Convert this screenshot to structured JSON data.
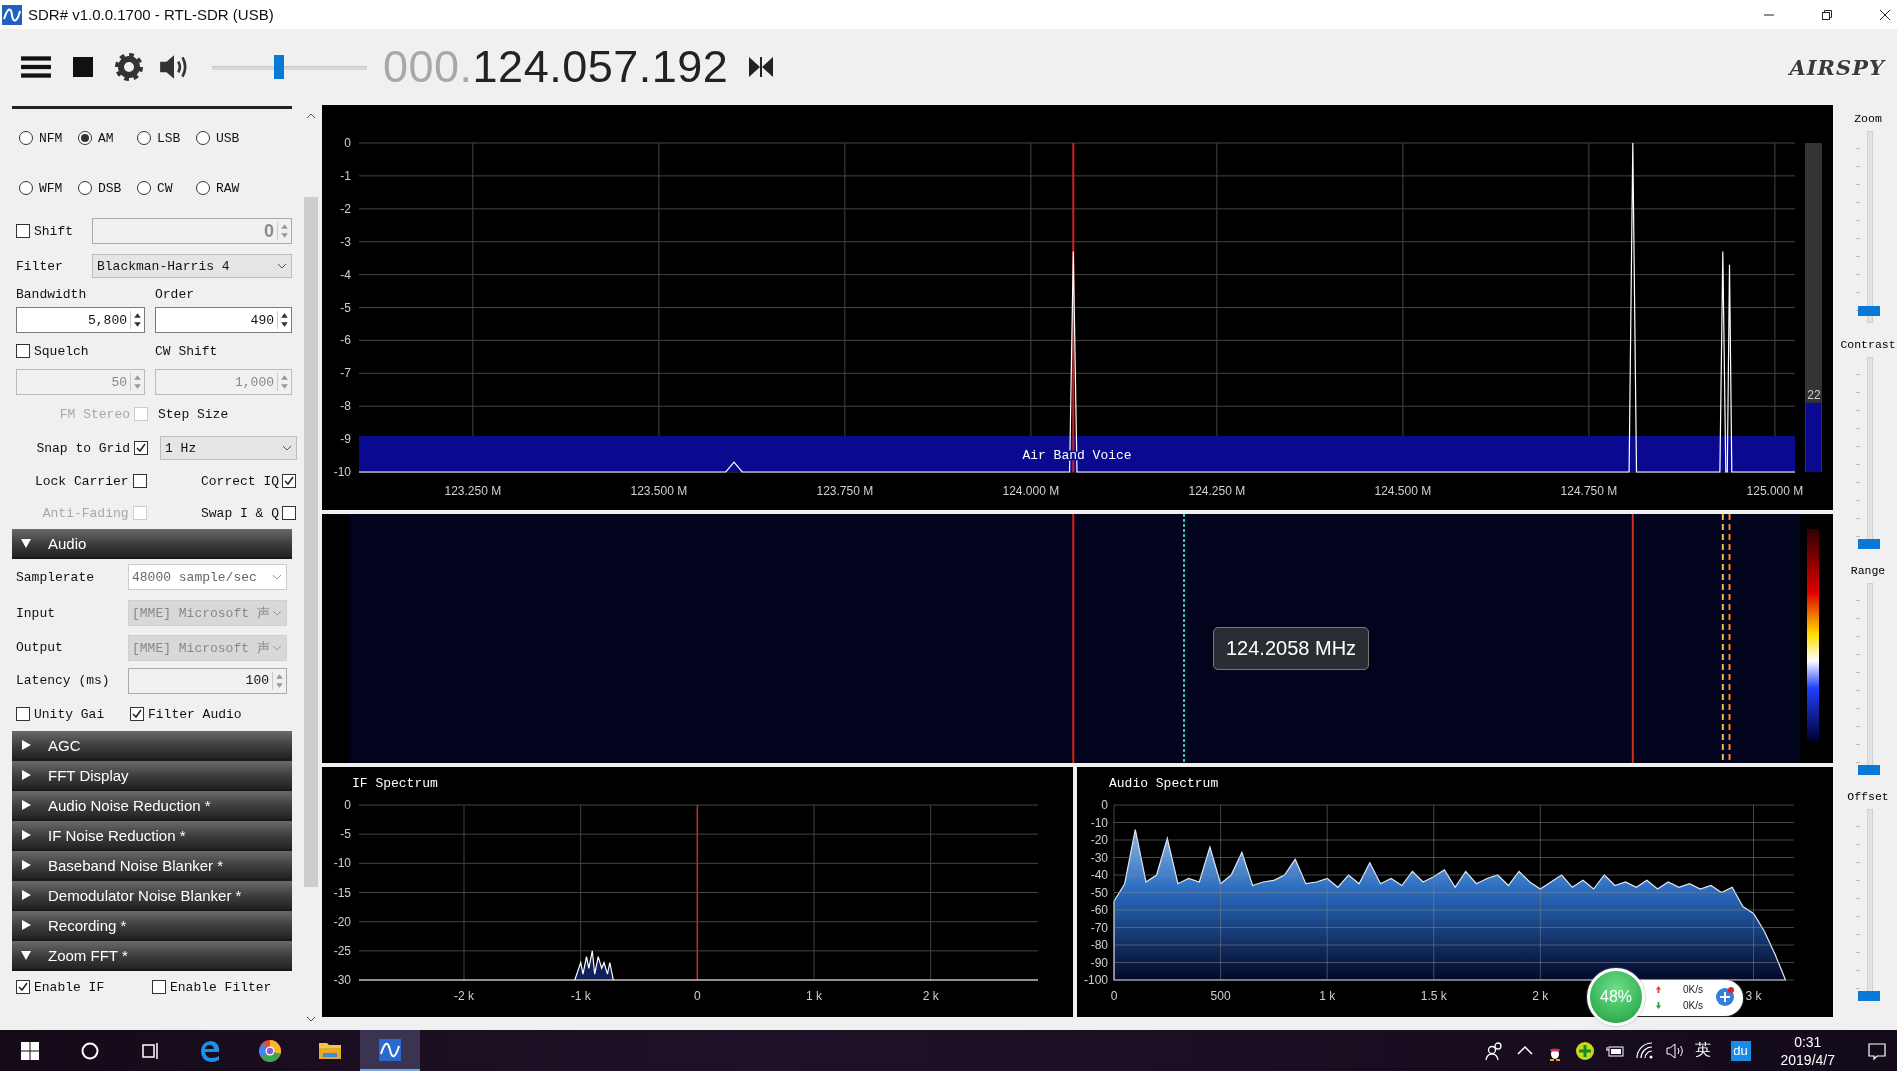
{
  "window": {
    "title": "SDR# v1.0.0.1700 - RTL-SDR (USB)"
  },
  "toolbar": {
    "volume": {
      "level": 0.43
    },
    "frequency": {
      "leading": "000.",
      "digits": "124.057.192"
    },
    "logo": "AIRSPY"
  },
  "modes": [
    {
      "label": "NFM",
      "selected": false
    },
    {
      "label": "AM",
      "selected": true
    },
    {
      "label": "LSB",
      "selected": false
    },
    {
      "label": "USB",
      "selected": false
    },
    {
      "label": "WFM",
      "selected": false
    },
    {
      "label": "DSB",
      "selected": false
    },
    {
      "label": "CW",
      "selected": false
    },
    {
      "label": "RAW",
      "selected": false
    }
  ],
  "shift": {
    "label": "Shift",
    "checked": false,
    "value": "0"
  },
  "filter": {
    "label": "Filter",
    "value": "Blackman-Harris 4"
  },
  "bandwidth": {
    "label": "Bandwidth",
    "value": "5,800"
  },
  "order": {
    "label": "Order",
    "value": "490"
  },
  "squelch": {
    "label": "Squelch",
    "checked": false,
    "value": "50",
    "disabled": true
  },
  "cw_shift": {
    "label": "CW Shift",
    "value": "1,000",
    "disabled": true
  },
  "left_options": [
    {
      "label": "FM Stereo",
      "checked": false,
      "disabled": true
    },
    {
      "label": "Snap to Grid",
      "checked": true,
      "disabled": false
    },
    {
      "label": "Lock Carrier",
      "checked": false,
      "disabled": false
    },
    {
      "label": "Anti-Fading",
      "checked": false,
      "disabled": true
    }
  ],
  "step_size": {
    "label": "Step Size",
    "value": "1 Hz"
  },
  "right_options": [
    {
      "label": "Correct IQ",
      "checked": true
    },
    {
      "label": "Swap I & Q",
      "checked": false
    }
  ],
  "audio": {
    "title": "Audio",
    "expanded": true,
    "fields": [
      {
        "kind": "dropdown",
        "label": "Samplerate",
        "value": "48000 sample/sec",
        "disabled": false
      },
      {
        "kind": "dropdown",
        "label": "Input",
        "value": "[MME] Microsoft 声",
        "disabled": true
      },
      {
        "kind": "dropdown",
        "label": "Output",
        "value": "[MME] Microsoft 声",
        "disabled": true
      },
      {
        "kind": "spinner",
        "label": "Latency (ms)",
        "value": "100",
        "disabled": false
      }
    ],
    "checks": [
      {
        "label": "Unity Gai",
        "checked": false
      },
      {
        "label": "Filter Audio",
        "checked": true
      }
    ]
  },
  "sections": [
    {
      "title": "AGC",
      "expanded": false
    },
    {
      "title": "FFT Display",
      "expanded": false
    },
    {
      "title": "Audio Noise Reduction *",
      "expanded": false
    },
    {
      "title": "IF Noise Reduction *",
      "expanded": false
    },
    {
      "title": "Baseband Noise Blanker *",
      "expanded": false
    },
    {
      "title": "Demodulator Noise Blanker *",
      "expanded": false
    },
    {
      "title": "Recording *",
      "expanded": false
    },
    {
      "title": "Zoom FFT *",
      "expanded": true
    }
  ],
  "zoom_fft": {
    "checks": [
      {
        "label": "Enable IF",
        "checked": true
      },
      {
        "label": "Enable Filter",
        "checked": false
      }
    ]
  },
  "spectrum": {
    "meter": {
      "label": "22",
      "level": 0.21
    },
    "chart_data": {
      "type": "line",
      "x": [
        123.097,
        123.59,
        123.601,
        123.612,
        124.052,
        124.057,
        124.062,
        124.804,
        124.809,
        124.814,
        124.926,
        124.93,
        124.934,
        124.936,
        124.939,
        124.942,
        125.027
      ],
      "series": [
        {
          "color": "#ffffff",
          "values": [
            -10,
            -10,
            -9.7,
            -10,
            -10,
            -3.3,
            -10,
            -10,
            0,
            -10,
            -10,
            -3.3,
            -10,
            -10,
            -3.7,
            -10,
            -10
          ]
        }
      ],
      "xlim": [
        123.097,
        125.027
      ],
      "ylim": [
        -10,
        0
      ],
      "grid": true,
      "bands": [
        {
          "axis": "y",
          "from": -10,
          "to": -8.9,
          "color": "#0a0a90",
          "label": "Air Band Voice"
        }
      ],
      "ref_lines": [
        {
          "axis": "x",
          "value": 124.057,
          "color": "#d02020"
        }
      ],
      "xticks": [
        {
          "value": 123.25,
          "label": "123.250 M"
        },
        {
          "value": 123.5,
          "label": "123.500 M"
        },
        {
          "value": 123.75,
          "label": "123.750 M"
        },
        {
          "value": 124,
          "label": "124.000 M"
        },
        {
          "value": 124.25,
          "label": "124.250 M"
        },
        {
          "value": 124.5,
          "label": "124.500 M"
        },
        {
          "value": 124.75,
          "label": "124.750 M"
        },
        {
          "value": 125,
          "label": "125.000 M"
        }
      ],
      "yticks": [
        0,
        -1,
        -2,
        -3,
        -4,
        -5,
        -6,
        -7,
        -8,
        -9,
        -10
      ]
    }
  },
  "waterfall": {
    "tooltip": "124.2058 MHz"
  },
  "if_spectrum": {
    "title": "IF Spectrum",
    "chart_data": {
      "type": "area",
      "x": [
        -2.9,
        -1.05,
        -1.0,
        -0.98,
        -0.95,
        -0.93,
        -0.9,
        -0.88,
        -0.85,
        -0.82,
        -0.8,
        -0.77,
        -0.75,
        -0.72,
        2.92
      ],
      "series": [
        {
          "color": "#ffffff",
          "values": [
            -30,
            -30,
            -27,
            -29,
            -26,
            -28,
            -25,
            -29,
            -26,
            -28,
            -27,
            -29,
            -27,
            -30,
            -30
          ]
        }
      ],
      "xlim": [
        -2.9,
        2.92
      ],
      "ylim": [
        -30,
        0
      ],
      "grid": true,
      "ref_lines": [
        {
          "axis": "x",
          "value": 0,
          "color": "#d02020"
        }
      ],
      "xticks": [
        {
          "value": -2,
          "label": "-2 k"
        },
        {
          "value": -1,
          "label": "-1 k"
        },
        {
          "value": 0,
          "label": "0"
        },
        {
          "value": 1,
          "label": "1 k"
        },
        {
          "value": 2,
          "label": "2 k"
        }
      ],
      "yticks": [
        0,
        -5,
        -10,
        -15,
        -20,
        -25,
        -30
      ]
    }
  },
  "audio_spectrum": {
    "title": "Audio Spectrum",
    "chart_data": {
      "type": "area",
      "x": [
        0,
        0,
        50,
        100,
        150,
        200,
        250,
        300,
        350,
        400,
        450,
        500,
        550,
        600,
        650,
        700,
        750,
        800,
        850,
        900,
        950,
        1000,
        1050,
        1100,
        1150,
        1200,
        1250,
        1300,
        1350,
        1400,
        1450,
        1500,
        1550,
        1600,
        1650,
        1700,
        1750,
        1800,
        1850,
        1900,
        1950,
        2000,
        2050,
        2100,
        2150,
        2200,
        2250,
        2300,
        2350,
        2400,
        2450,
        2500,
        2550,
        2600,
        2650,
        2700,
        2750,
        2800,
        2850,
        2900,
        2950,
        3000,
        3050,
        3100,
        3150
      ],
      "series": [
        {
          "color": "#dfe9f5",
          "values": [
            -100,
            -55,
            -45,
            -14,
            -44,
            -40,
            -19,
            -45,
            -42,
            -44,
            -24,
            -45,
            -40,
            -27,
            -46,
            -44,
            -43,
            -40,
            -31,
            -45,
            -44,
            -42,
            -47,
            -40,
            -45,
            -33,
            -45,
            -42,
            -46,
            -38,
            -44,
            -41,
            -37,
            -47,
            -38,
            -45,
            -42,
            -40,
            -46,
            -38,
            -44,
            -48,
            -44,
            -40,
            -47,
            -43,
            -48,
            -40,
            -46,
            -44,
            -47,
            -43,
            -48,
            -44,
            -47,
            -45,
            -48,
            -46,
            -50,
            -47,
            -58,
            -62,
            -72,
            -85,
            -100
          ]
        }
      ],
      "xlim": [
        0,
        3190
      ],
      "ylim": [
        -100,
        0
      ],
      "grid": true,
      "xticks": [
        {
          "value": 0,
          "label": "0"
        },
        {
          "value": 500,
          "label": "500"
        },
        {
          "value": 1000,
          "label": "1 k"
        },
        {
          "value": 1500,
          "label": "1.5 k"
        },
        {
          "value": 2000,
          "label": "2 k"
        },
        {
          "value": 3000,
          "label": "3 k"
        }
      ],
      "yticks": [
        0,
        -10,
        -20,
        -30,
        -40,
        -50,
        -60,
        -70,
        -80,
        -90,
        -100
      ]
    }
  },
  "side_sliders": [
    {
      "label": "Zoom",
      "level": 0.04
    },
    {
      "label": "Contrast",
      "level": 0
    },
    {
      "label": "Range",
      "level": 0
    },
    {
      "label": "Offset",
      "level": 0
    }
  ],
  "net_widget": {
    "percent": "48%",
    "upload": "0K/s",
    "download": "0K/s"
  },
  "taskbar": {
    "apps": [
      {
        "kind": "edge",
        "selected": false
      },
      {
        "kind": "browser",
        "selected": false
      },
      {
        "kind": "folder",
        "selected": false
      },
      {
        "kind": "sdr",
        "selected": true
      }
    ],
    "ime": "英",
    "ime_logo": "du",
    "time": "0:31",
    "date": "2019/4/7"
  }
}
